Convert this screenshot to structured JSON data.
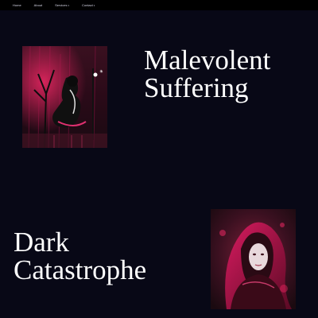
{
  "nav": {
    "items": [
      {
        "label": "Home",
        "has_dropdown": false
      },
      {
        "label": "About",
        "has_dropdown": false
      },
      {
        "label": "Services",
        "has_dropdown": true
      },
      {
        "label": "Contact",
        "has_dropdown": true
      }
    ]
  },
  "sections": [
    {
      "title_line1": "Malevolent",
      "title_line2": "Suffering"
    },
    {
      "title_line1": "Dark",
      "title_line2": "Catastrophe"
    }
  ],
  "colors": {
    "page_background": "#080816",
    "navbar_background": "#000000",
    "title_text": "#ffffff",
    "accent_crimson": "#c2185b"
  }
}
